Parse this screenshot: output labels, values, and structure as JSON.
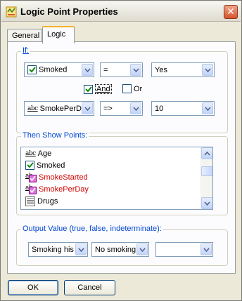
{
  "window": {
    "title": "Logic Point Properties",
    "close_glyph": "✕",
    "icon": "logic-point-icon"
  },
  "tabs": [
    {
      "label": "General"
    },
    {
      "label": "Logic"
    }
  ],
  "if_group": {
    "legend": "If:",
    "row1": {
      "field": "Smoked",
      "field_icon": "checkbox-icon",
      "operator": "=",
      "value": "Yes"
    },
    "and_label": "And",
    "or_label": "Or",
    "and_checked": true,
    "or_checked": false,
    "row2": {
      "field": "SmokePerDa",
      "field_icon": "abc-text-icon",
      "field_icon_text": "abc",
      "operator": "=>",
      "value": "10"
    }
  },
  "then_group": {
    "legend": "Then Show Points:",
    "items": [
      {
        "label": "Age",
        "icon": "abc-text-icon",
        "icon_text": "abc",
        "color": "#000000"
      },
      {
        "label": "Smoked",
        "icon": "checkbox-icon",
        "color": "#000000"
      },
      {
        "label": "SmokeStarted",
        "icon": "abc-text-checked-icon",
        "icon_text": "ab",
        "color": "#d40000"
      },
      {
        "label": "SmokePerDay",
        "icon": "abc-text-checked-icon",
        "icon_text": "ab",
        "color": "#d40000"
      },
      {
        "label": "Drugs",
        "icon": "list-icon",
        "color": "#000000"
      }
    ]
  },
  "output_group": {
    "legend": "Output Value (true, false, indeterminate):",
    "true_value": "Smoking his",
    "false_value": "No smoking",
    "indeterminate_value": ""
  },
  "buttons": {
    "ok": "OK",
    "cancel": "Cancel"
  }
}
